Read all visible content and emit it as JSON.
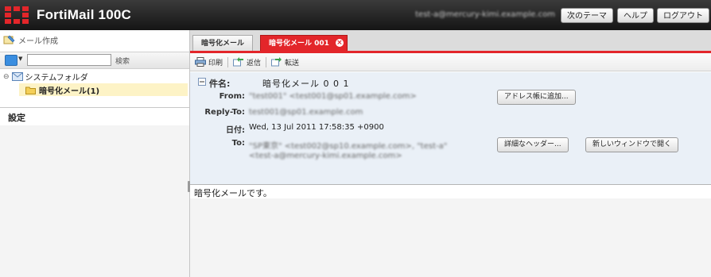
{
  "app": {
    "title": "FortiMail 100C",
    "user_email": "test-a@mercury-kimi.example.com",
    "buttons": {
      "theme": "次のテーマ",
      "help": "ヘルプ",
      "logout": "ログアウト"
    }
  },
  "sidebar": {
    "compose_label": "メール作成",
    "search_placeholder": "",
    "search_label": "検索",
    "folder_root": "システムフォルダ",
    "folder_child": "暗号化メール(1)",
    "settings_label": "設定"
  },
  "tabs": [
    {
      "label": "暗号化メール"
    },
    {
      "label": "暗号化メール 001"
    }
  ],
  "toolbar": {
    "print": "印刷",
    "reply": "返信",
    "forward": "転送"
  },
  "message": {
    "subject_label": "件名:",
    "subject": "暗号化メール 0 0 1",
    "from_label": "From:",
    "from": "\"test001\" <test001@sp01.example.com>",
    "replyto_label": "Reply-To:",
    "replyto": "test001@sp01.example.com",
    "date_label": "日付:",
    "date": "Wed, 13 Jul 2011 17:58:35 +0900",
    "to_label": "To:",
    "to_line1": "\"SP東京\" <test002@sp10.example.com>, \"test-a\"",
    "to_line2": "<test-a@mercury-kimi.example.com>",
    "add_address_button": "アドレス帳に追加...",
    "detail_header_button": "詳細なヘッダー...",
    "new_window_button": "新しいウィンドウで開く",
    "body": "暗号化メールです。"
  },
  "colors": {
    "brand": "#e3262a",
    "header_bg": "#eaf0f7",
    "folder_highlight": "#fdf3c6"
  }
}
